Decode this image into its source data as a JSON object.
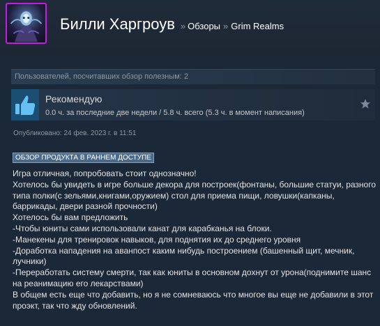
{
  "header": {
    "user_name": "Билли Харгроув",
    "sep": "»",
    "crumb_reviews": "Обзоры",
    "crumb_game": "Grim Realms"
  },
  "helpful": {
    "text": "Пользователей, посчитавших обзор полезным: 2"
  },
  "recommendation": {
    "title": "Рекомендую",
    "hours": "0.0 ч. за последние две недели / 5.8 ч. всего (5.3 ч. в момент написания)",
    "icon": "thumbs-up-icon"
  },
  "posted": "Опубликовано: 24 фев. 2023 г. в 11:51",
  "early_access_label": "ОБЗОР ПРОДУКТА В РАННЕМ ДОСТУПЕ",
  "review_lines": [
    "Игра отличная, попробовать стоит однозначно!",
    "Хотелось бы увидеть в игре больше декора для построек(фонтаны, большие статуи, разного типа полки(с зельями,книгами,оружием) стол для приема пищи, ловушки(капканы, баррикады, двери разной прочности)",
    "Хотелось бы вам предложить",
    "-Чтобы юниты сами использовали канат для карабканья на блоки.",
    "-Манекены для тренировок навыков, для поднятия их до среднего уровня",
    "-Доработка нападения на аванпост каким нибудь построением (башенный щит, мечник, лучники)",
    "-Переработать систему смерти, так как юниты в основном дохнут от урона(поднимите шанс на реанимацию его лекарствами)",
    "В общем есть еще что добавить, но я не сомневаюсь что многое вы еще не добавили в этот проэкт, так что жду обновлений."
  ],
  "colors": {
    "background": "#1b2838",
    "avatar_border": "#c21de0",
    "thumb_bg": "#1a4e73",
    "badge_bg": "#4c6b8a"
  }
}
